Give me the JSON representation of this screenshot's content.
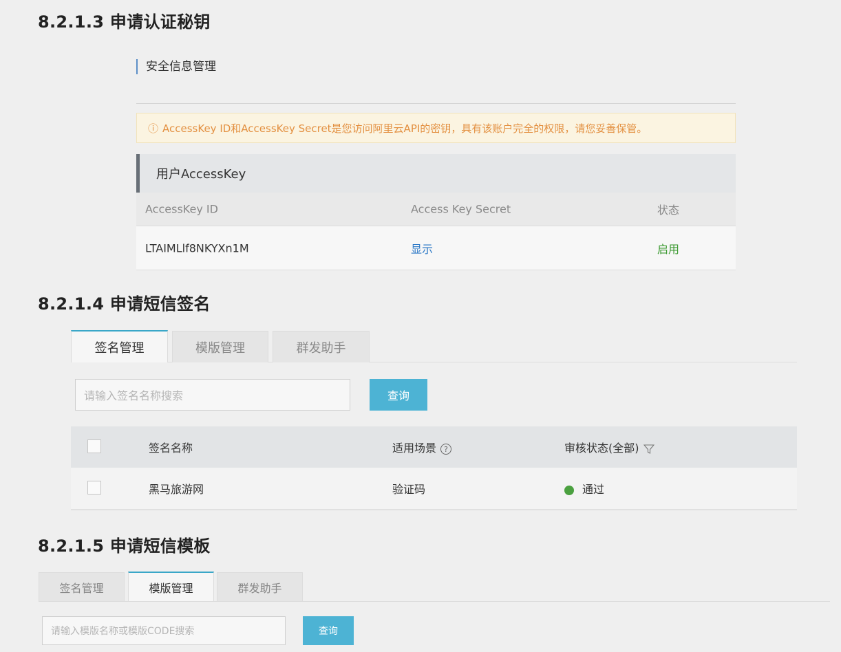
{
  "section_813": {
    "heading": "8.2.1.3 申请认证秘钥",
    "panel_title": "安全信息管理",
    "warning_icon": "ⓘ",
    "warning_text": "AccessKey ID和AccessKey Secret是您访问阿里云API的密钥，具有该账户完全的权限，请您妥善保管。",
    "user_accesskey_title": "用户AccessKey",
    "columns": [
      "AccessKey ID",
      "Access Key Secret",
      "状态"
    ],
    "row": {
      "access_key_id": "LTAIMLlf8NKYXn1M",
      "secret_action": "显示",
      "status": "启用"
    }
  },
  "section_814": {
    "heading": "8.2.1.4 申请短信签名",
    "tabs": [
      "签名管理",
      "模版管理",
      "群发助手"
    ],
    "active_tab": "签名管理",
    "search_placeholder": "请输入签名名称搜索",
    "query_button": "查询",
    "columns": [
      "签名名称",
      "适用场景",
      "审核状态(全部)"
    ],
    "help_icon": "?",
    "row": {
      "name": "黑马旅游网",
      "scene": "验证码",
      "status": "通过"
    },
    "colors": {
      "status_dot": "#4aa03f",
      "accent": "#4db3d4"
    }
  },
  "section_815": {
    "heading": "8.2.1.5 申请短信模板",
    "tabs": [
      "签名管理",
      "模版管理",
      "群发助手"
    ],
    "active_tab": "模版管理",
    "search_placeholder": "请输入模版名称或模版CODE搜索",
    "query_button": "查询"
  }
}
